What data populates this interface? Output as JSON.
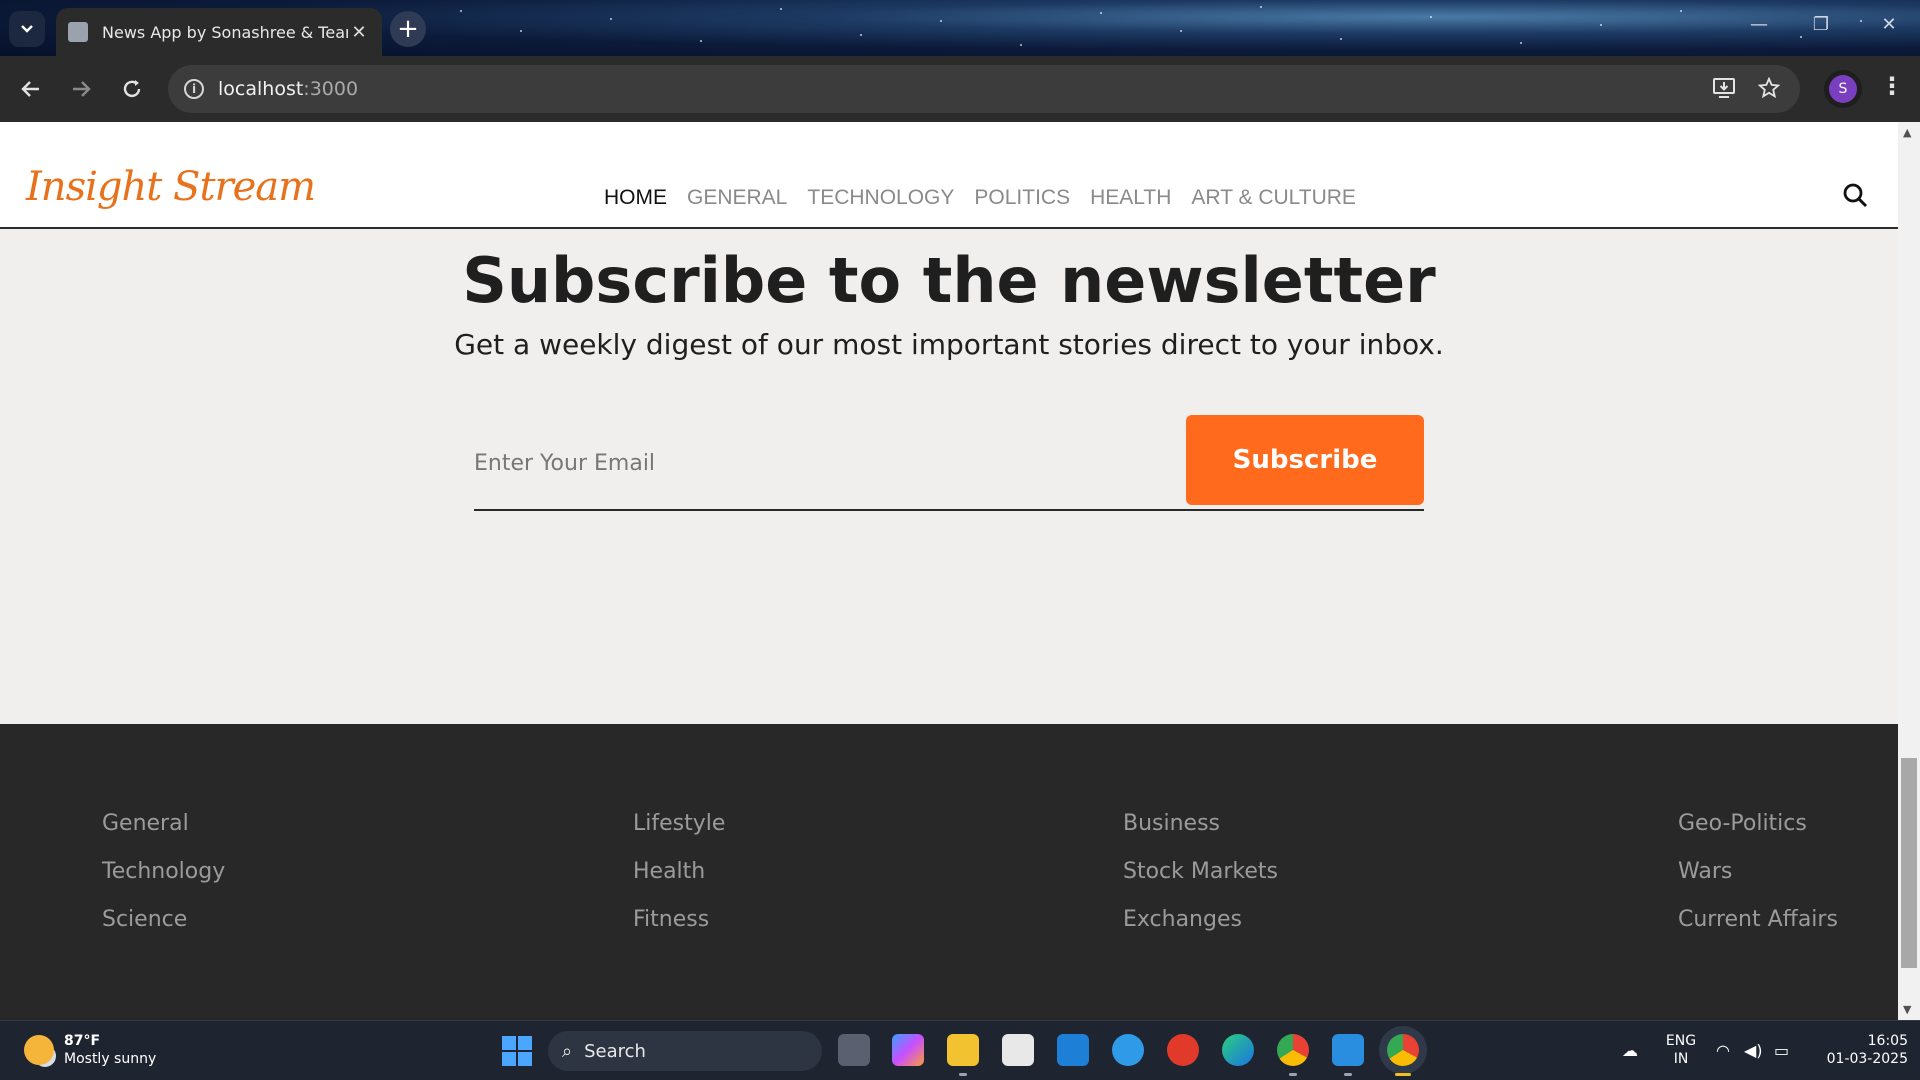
{
  "browser": {
    "tab_title": "News App by Sonashree & Team",
    "tab_close": "✕",
    "new_tab": "+",
    "url_host": "localhost",
    "url_port": ":3000",
    "profile_initial": "S",
    "window_min": "—",
    "window_restore": "❐",
    "window_close": "✕"
  },
  "header": {
    "logo": "Insight Stream",
    "nav": [
      "HOME",
      "GENERAL",
      "TECHNOLOGY",
      "POLITICS",
      "HEALTH",
      "ART & CULTURE"
    ],
    "active_nav": "HOME"
  },
  "newsletter": {
    "title": "Subscribe to the newsletter",
    "subtitle": "Get a weekly digest of our most important stories direct to your inbox.",
    "email_placeholder": "Enter Your Email",
    "button_label": "Subscribe",
    "accent_color": "#ff6a1c"
  },
  "footer": {
    "columns": [
      [
        "General",
        "Technology",
        "Science"
      ],
      [
        "Lifestyle",
        "Health",
        "Fitness"
      ],
      [
        "Business",
        "Stock Markets",
        "Exchanges"
      ],
      [
        "Geo-Politics",
        "Wars",
        "Current Affairs"
      ]
    ]
  },
  "taskbar": {
    "weather_temp": "87°F",
    "weather_desc": "Mostly sunny",
    "search_label": "Search",
    "language": "ENG",
    "region": "IN",
    "time": "16:05",
    "date": "01-03-2025"
  }
}
